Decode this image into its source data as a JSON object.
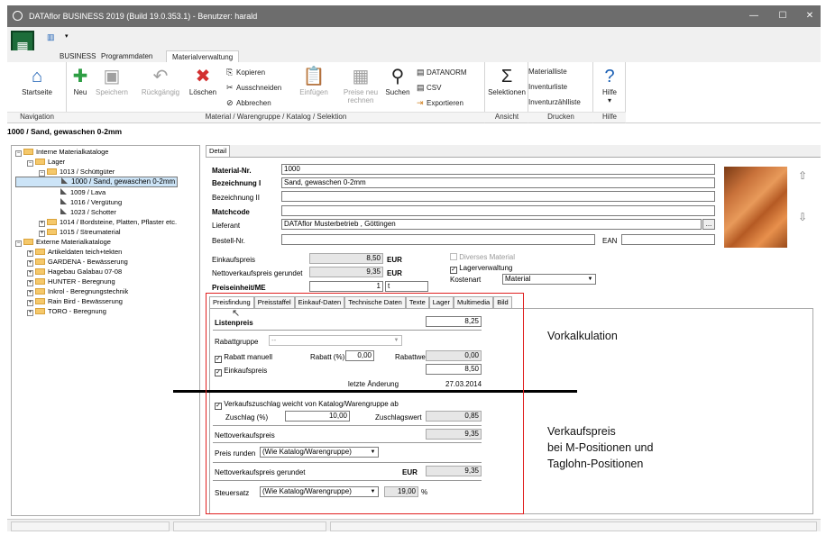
{
  "window": {
    "title": "DATAflor BUSINESS 2019 (Build 19.0.353.1) - Benutzer: harald",
    "minimize": "—",
    "maximize": "☐",
    "close": "✕"
  },
  "qat": {
    "app_icon": "calculator-icon",
    "qat_icon": "grid-icon",
    "qat_arrow": "▾"
  },
  "tabs": [
    "BUSINESS",
    "Programmdaten",
    "Materialverwaltung"
  ],
  "ribbon": {
    "startseite": "Startseite",
    "neu": "Neu",
    "speichern": "Speichern",
    "rueckgaengig": "Rückgängig",
    "loeschen": "Löschen",
    "kopieren": "Kopieren",
    "ausschneiden": "Ausschneiden",
    "abbrechen": "Abbrechen",
    "einfuegen": "Einfügen",
    "preise_neu": "Preise neu",
    "rechnen": "rechnen",
    "suchen": "Suchen",
    "datanorm": "DATANORM",
    "csv": "CSV",
    "exportieren": "Exportieren",
    "selektionen": "Selektionen",
    "materialliste": "Materialliste",
    "inventurliste": "Inventurliste",
    "inventurzaehlliste": "Inventurzählliste",
    "hilfe": "Hilfe",
    "hilfe_arrow": "▾",
    "groups": {
      "navigation": "Navigation",
      "material": "Material / Warengruppe / Katalog / Selektion",
      "ansicht": "Ansicht",
      "drucken": "Drucken",
      "hilfe": "Hilfe"
    }
  },
  "header": "1000 / Sand, gewaschen 0-2mm",
  "tree": [
    {
      "label": "Interne Materialkataloge",
      "level": 0,
      "exp": "⊟",
      "type": "folder"
    },
    {
      "label": "Lager",
      "level": 1,
      "exp": "⊟",
      "type": "folder"
    },
    {
      "label": "1013 / Schüttgüter",
      "level": 2,
      "exp": "⊟",
      "type": "folder"
    },
    {
      "label": "1000 / Sand, gewaschen 0-2mm",
      "level": 3,
      "exp": "",
      "type": "doc",
      "selected": true
    },
    {
      "label": "1009 / Lava",
      "level": 3,
      "exp": "",
      "type": "doc"
    },
    {
      "label": "1016 / Vergütung",
      "level": 3,
      "exp": "",
      "type": "doc"
    },
    {
      "label": "1023 / Schotter",
      "level": 3,
      "exp": "",
      "type": "doc"
    },
    {
      "label": "1014 / Bordsteine, Platten, Pflaster etc.",
      "level": 2,
      "exp": "⊞",
      "type": "folder"
    },
    {
      "label": "1015 / Streumaterial",
      "level": 2,
      "exp": "⊞",
      "type": "folder"
    },
    {
      "label": "Externe Materialkataloge",
      "level": 0,
      "exp": "⊟",
      "type": "folder"
    },
    {
      "label": "Artikeldaten teich+tekten",
      "level": 1,
      "exp": "⊞",
      "type": "folder"
    },
    {
      "label": "GARDENA - Bewässerung",
      "level": 1,
      "exp": "⊞",
      "type": "folder"
    },
    {
      "label": "Hagebau Galabau 07-08",
      "level": 1,
      "exp": "⊞",
      "type": "folder"
    },
    {
      "label": "HUNTER - Beregnung",
      "level": 1,
      "exp": "⊞",
      "type": "folder"
    },
    {
      "label": "Inkrol - Beregnungstechnik",
      "level": 1,
      "exp": "⊞",
      "type": "folder"
    },
    {
      "label": "Rain Bird - Bewässerung",
      "level": 1,
      "exp": "⊞",
      "type": "folder"
    },
    {
      "label": "TORO - Beregnung",
      "level": 1,
      "exp": "⊞",
      "type": "folder"
    }
  ],
  "detail": {
    "tab": "Detail",
    "material_nr_label": "Material-Nr.",
    "material_nr": "1000",
    "bez1_label": "Bezeichnung I",
    "bez1": "Sand, gewaschen 0-2mm",
    "bez2_label": "Bezeichnung II",
    "bez2": "",
    "matchcode_label": "Matchcode",
    "matchcode": "",
    "lieferant_label": "Lieferant",
    "lieferant": "DATAflor Musterbetrieb , Göttingen",
    "lieferant_btn": "...",
    "bestell_label": "Bestell-Nr.",
    "bestell": "",
    "ean_label": "EAN",
    "ean": "",
    "ek_label": "Einkaufspreis",
    "ek": "8,50",
    "ek_cur": "EUR",
    "nvp_label": "Nettoverkaufspreis gerundet",
    "nvp": "9,35",
    "nvp_cur": "EUR",
    "pe_label": "Preiseinheit/ME",
    "pe": "1",
    "me": "t",
    "diverses": "Diverses Material",
    "lagerverwaltung": "Lagerverwaltung",
    "kostenart_label": "Kostenart",
    "kostenart": "Material",
    "img_up": "⇧",
    "img_down": "⇩"
  },
  "subtabs": [
    "Preisfindung",
    "Preisstaffel",
    "Einkauf-Daten",
    "Technische Daten",
    "Texte",
    "Lager",
    "Multimedia",
    "Bild"
  ],
  "preisfindung": {
    "listenpreis_label": "Listenpreis",
    "listenpreis": "8,25",
    "rabattgruppe_label": "Rabattgruppe",
    "rabattgruppe": "--",
    "rabatt_manuell": "Rabatt manuell",
    "rabatt_pct_label": "Rabatt (%)",
    "rabatt_pct": "0,00",
    "rabattwert_label": "Rabattwert",
    "rabattwert": "0,00",
    "einkaufspreis_label": "Einkaufspreis",
    "einkaufspreis": "8,50",
    "letzte_label": "letzte Änderung",
    "letzte": "27.03.2014",
    "zuschlag_weicht": "Verkaufszuschlag weicht von Katalog/Warengruppe ab",
    "zuschlag_label": "Zuschlag (%)",
    "zuschlag": "10,00",
    "zuschlagswert_label": "Zuschlagswert",
    "zuschlagswert": "0,85",
    "nvp_label": "Nettoverkaufspreis",
    "nvp": "9,35",
    "runden_label": "Preis runden",
    "runden": "(Wie Katalog/Warengruppe)",
    "nvpg_label": "Nettoverkaufspreis gerundet",
    "nvpg_cur": "EUR",
    "nvpg": "9,35",
    "steuer_label": "Steuersatz",
    "steuer": "(Wie Katalog/Warengruppe)",
    "steuer_pct": "19,00",
    "steuer_unit": "%"
  },
  "annotations": {
    "vorkalkulation": "Vorkalkulation",
    "vk1": "Verkaufspreis",
    "vk2": "bei M-Positionen und",
    "vk3": "Taglohn-Positionen"
  }
}
